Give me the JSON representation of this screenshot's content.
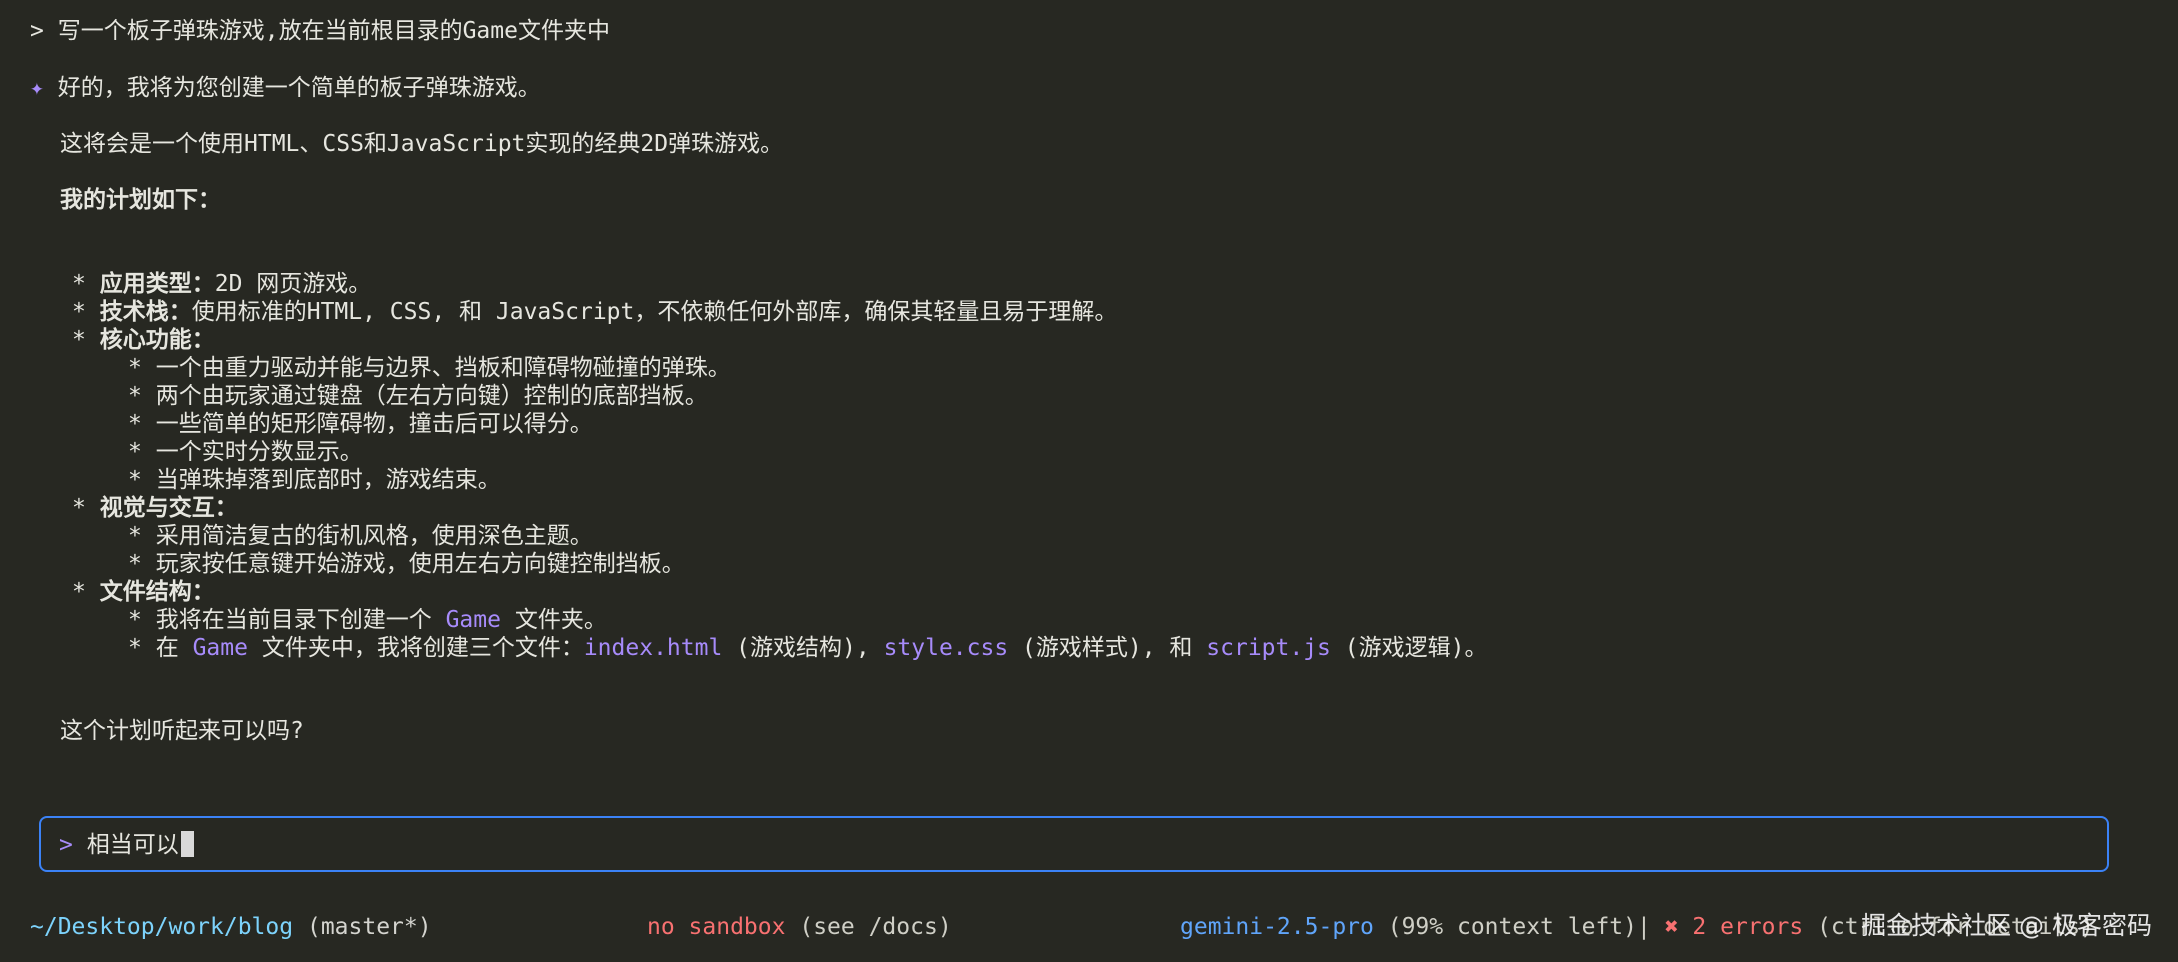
{
  "conversation": {
    "user_prompt_marker": ">",
    "user_prompt": "写一个板子弹珠游戏,放在当前根目录的Game文件夹中",
    "assistant_marker": "✦",
    "reply_intro": "好的，我将为您创建一个简单的板子弹珠游戏。",
    "reply_desc": "这将会是一个使用HTML、CSS和JavaScript实现的经典2D弹珠游戏。",
    "plan_heading": "我的计划如下：",
    "plan": {
      "app_type_label": "应用类型：",
      "app_type_value": "2D 网页游戏。",
      "tech_label": "技术栈：",
      "tech_value": "使用标准的HTML, CSS, 和 JavaScript，不依赖任何外部库，确保其轻量且易于理解。",
      "features_label": "核心功能：",
      "features": [
        "一个由重力驱动并能与边界、挡板和障碍物碰撞的弹珠。",
        "两个由玩家通过键盘（左右方向键）控制的底部挡板。",
        "一些简单的矩形障碍物，撞击后可以得分。",
        "一个实时分数显示。",
        "当弹珠掉落到底部时，游戏结束。"
      ],
      "visual_label": "视觉与交互：",
      "visual": [
        "采用简洁复古的街机风格，使用深色主题。",
        "玩家按任意键开始游戏，使用左右方向键控制挡板。"
      ],
      "files_label": "文件结构：",
      "files_line1_pre": "我将在当前目录下创建一个 ",
      "files_line1_code": "Game",
      "files_line1_post": " 文件夹。",
      "files_line2_pre": "在 ",
      "files_line2_code1": "Game",
      "files_line2_mid1": " 文件夹中，我将创建三个文件：",
      "files_line2_code2": "index.html",
      "files_line2_mid2": " (游戏结构), ",
      "files_line2_code3": "style.css",
      "files_line2_mid3": " (游戏样式), 和 ",
      "files_line2_code4": "script.js",
      "files_line2_post": " (游戏逻辑)。"
    },
    "bullet": "*",
    "question": "这个计划听起来可以吗?"
  },
  "input": {
    "prompt_marker": ">",
    "value": "相当可以"
  },
  "status_bar": {
    "path": "~/Desktop/work/blog",
    "branch": "(master*)",
    "sandbox": "no sandbox",
    "sandbox_hint": "(see /docs)",
    "model": "gemini-2.5-pro",
    "context": "(99% context left)|",
    "error_icon": "✖",
    "errors": "2 errors",
    "errors_hint": "(ctrl+o for details)"
  },
  "watermark": "掘金技术社区 @ 极客密码",
  "colors": {
    "background": "#272822",
    "accent": "#a78bfa",
    "input_border": "#3b82f6",
    "path": "#7dd3fc",
    "error": "#f87171",
    "model": "#60a5fa"
  }
}
